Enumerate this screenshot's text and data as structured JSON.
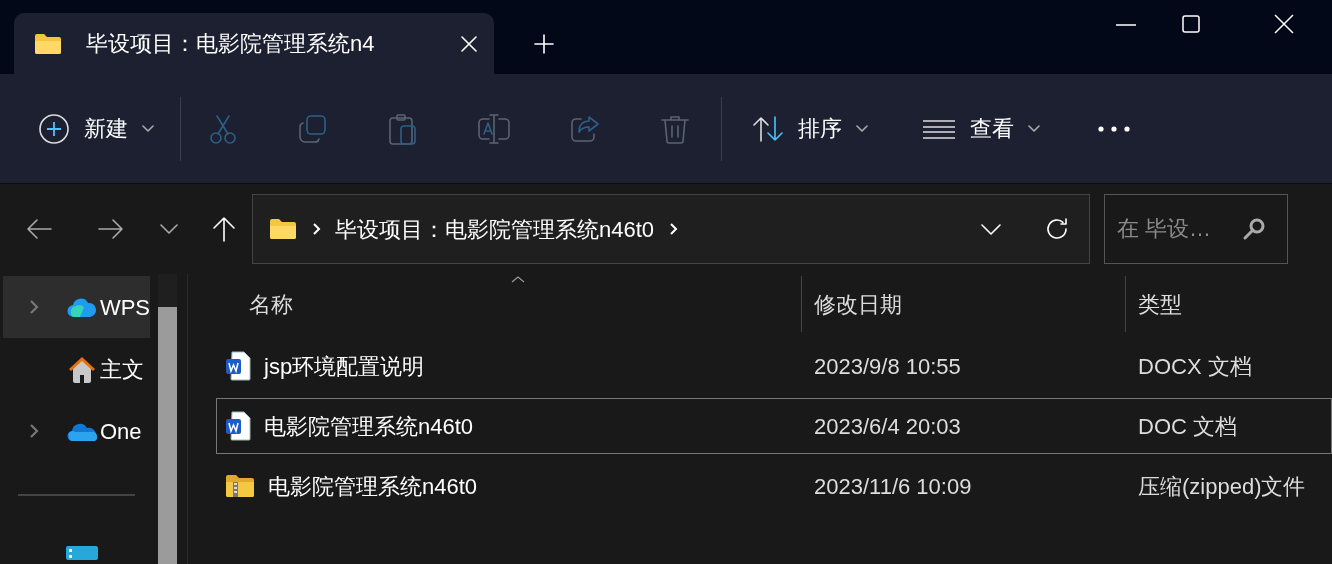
{
  "tabs": [
    {
      "title": "毕设项目：电影院管理系统n4",
      "selected": true
    }
  ],
  "toolbar": {
    "new_label": "新建",
    "sort_label": "排序",
    "view_label": "查看"
  },
  "address": {
    "path": "毕设项目：电影院管理系统n46t0"
  },
  "search": {
    "placeholder": "在 毕设…"
  },
  "sidebar": {
    "items": [
      {
        "label": "WPS",
        "kind": "wps",
        "expandable": true,
        "selected": true
      },
      {
        "label": "主文",
        "kind": "home",
        "expandable": false,
        "selected": false
      },
      {
        "label": "One",
        "kind": "onedrive",
        "expandable": true,
        "selected": false
      }
    ]
  },
  "table": {
    "columns": [
      "名称",
      "修改日期",
      "类型"
    ],
    "rows": [
      {
        "name": "jsp环境配置说明",
        "date": "2023/9/8 10:55",
        "type": "DOCX 文档",
        "kind": "word",
        "selected": false
      },
      {
        "name": "电影院管理系统n46t0",
        "date": "2023/6/4 20:03",
        "type": "DOC 文档",
        "kind": "word",
        "selected": true
      },
      {
        "name": "电影院管理系统n46t0",
        "date": "2023/11/6 10:09",
        "type": "压缩(zipped)文件",
        "kind": "zip",
        "selected": false
      }
    ]
  }
}
